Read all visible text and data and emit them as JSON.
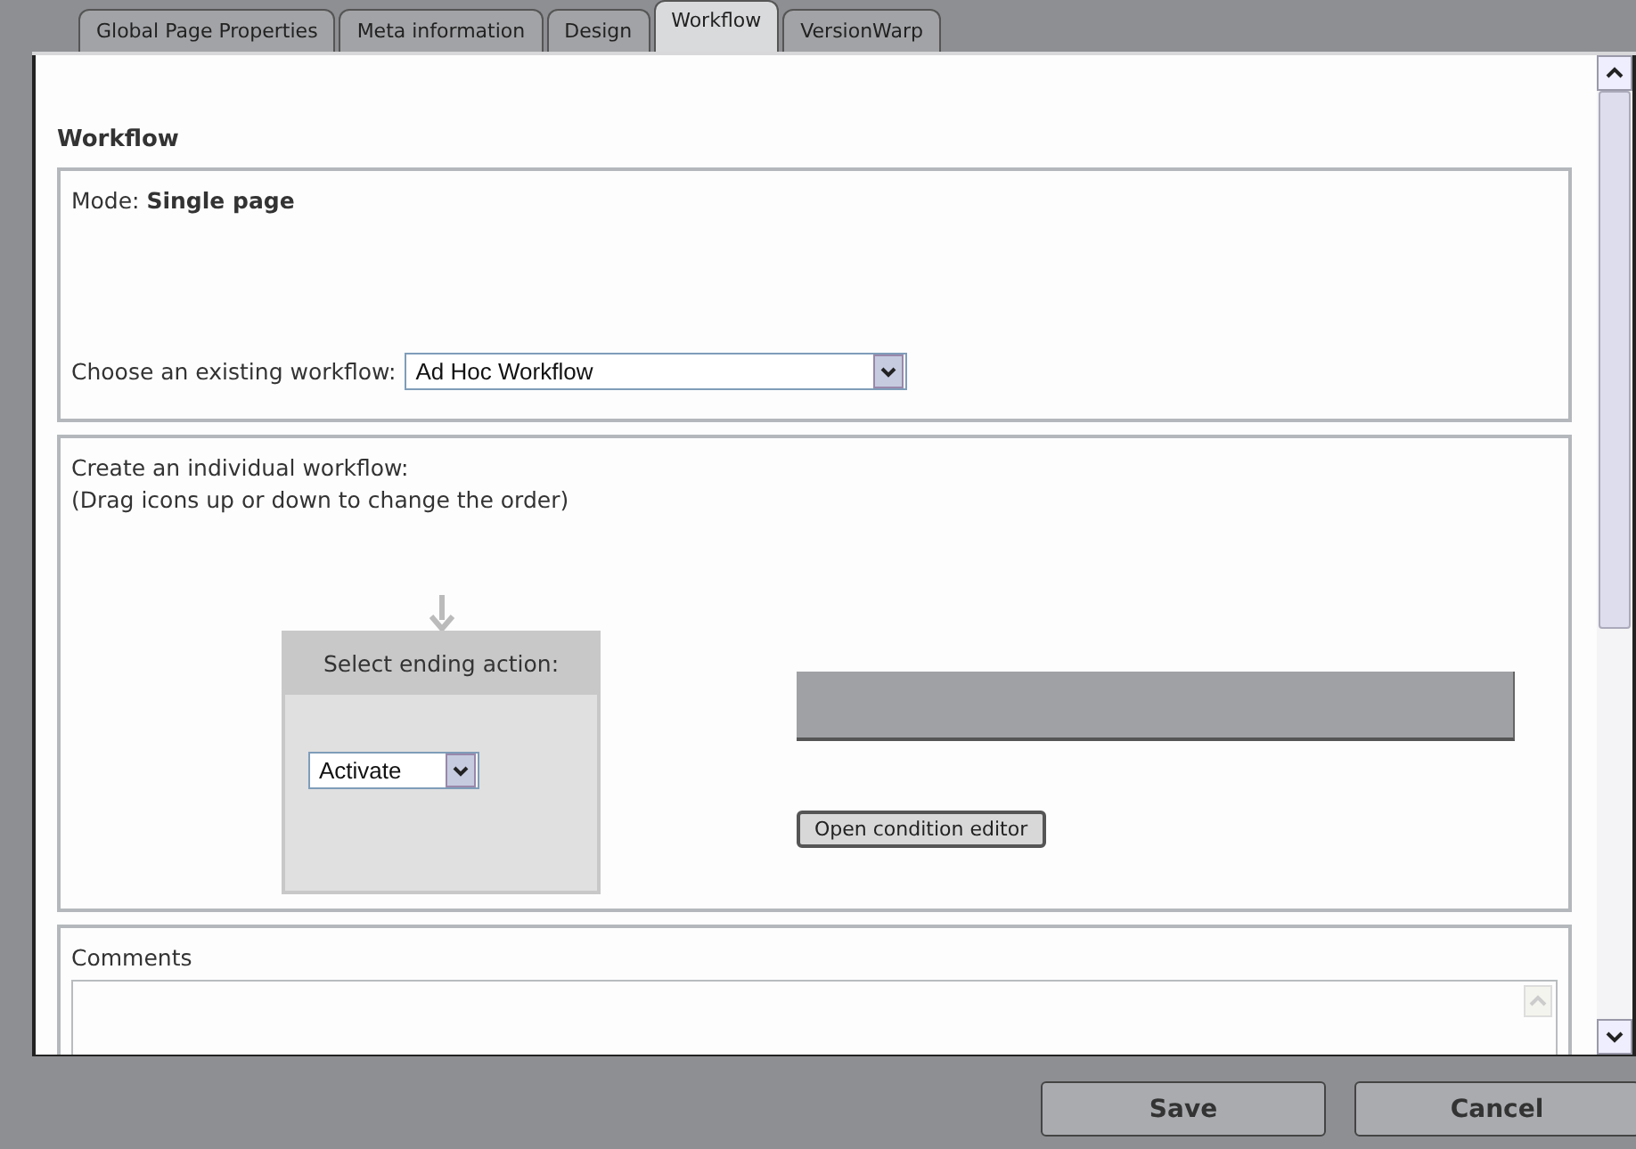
{
  "tabs": [
    {
      "label": "Global Page Properties",
      "selected": false
    },
    {
      "label": "Meta information",
      "selected": false
    },
    {
      "label": "Design",
      "selected": false
    },
    {
      "label": "Workflow",
      "selected": true
    },
    {
      "label": "VersionWarp",
      "selected": false
    }
  ],
  "heading": "Workflow",
  "mode": "Mode: **Single page**",
  "existing_workflow": {
    "label": "Choose an existing workflow:",
    "value": "Ad Hoc Workflow"
  },
  "individual_workflow": {
    "lines": [
      "Create an individual workflow:",
      "(Drag icons up or down to change the order)"
    ],
    "ending_action": {
      "title": "Select ending action:",
      "value": "Activate"
    },
    "condition_button": "Open condition editor"
  },
  "comments": {
    "label": "Comments"
  },
  "buttons": [
    "Save",
    "Cancel"
  ]
}
